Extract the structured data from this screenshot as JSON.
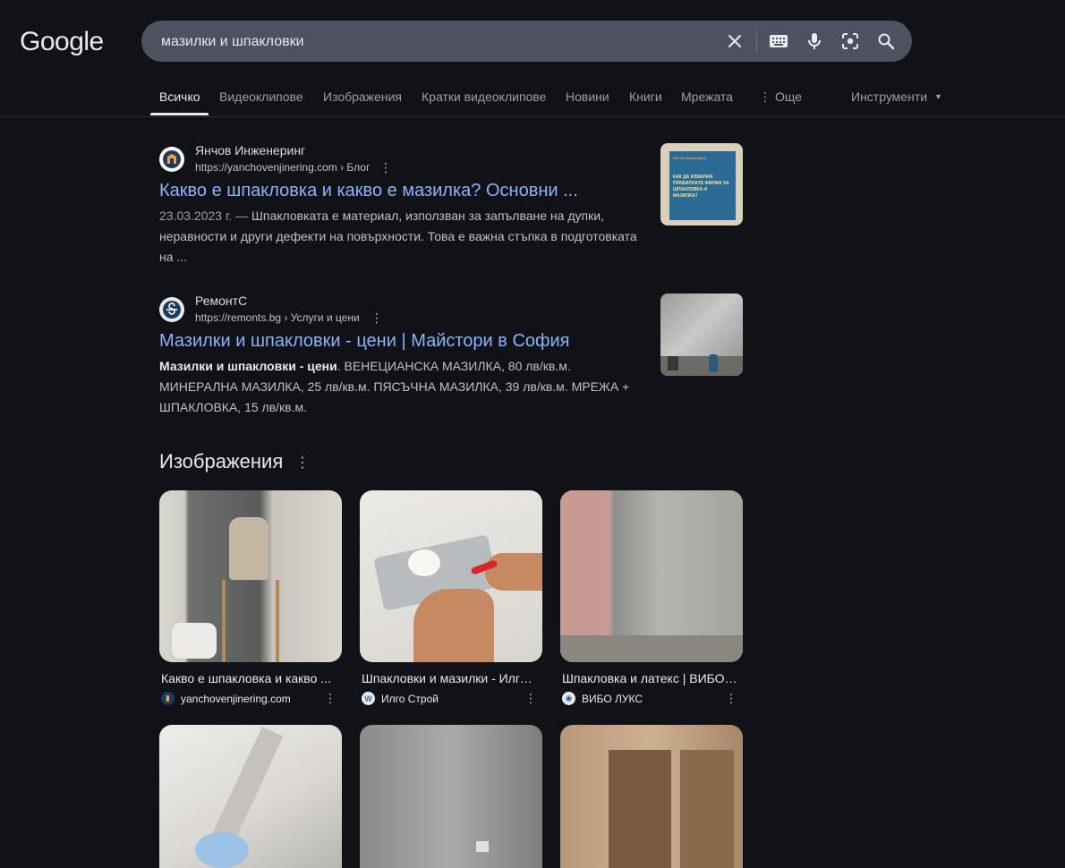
{
  "logo": "Google",
  "search": {
    "query": "мазилки и шпакловки"
  },
  "tabs": [
    "Всичко",
    "Видеоклипове",
    "Изображения",
    "Кратки видеоклипове",
    "Новини",
    "Книги",
    "Мрежата",
    "Още",
    "Инструменти"
  ],
  "results": [
    {
      "site": "Янчов Инженеринг",
      "url": "https://yanchovenjinering.com › Блог",
      "title": "Какво е шпакловка и какво е мазилка? Основни ...",
      "date": "23.03.2023 г. —",
      "snippet": "Шпакловката е материал, използван за запълване на дупки, неравности и други дефекти на повърхности. Това е важна стъпка в подготовката на ...",
      "thumb_lines": [
        "Янчов Инженеринг",
        "КАК ДА ИЗБЕРЕМ",
        "ПРАВИЛНАТА ФИРМА ЗА",
        "ШПАКЛОВКА И",
        "МАЗИЛКА?"
      ]
    },
    {
      "site": "РемонтС",
      "url": "https://remonts.bg › Услуги и цени",
      "title": "Мазилки и шпакловки - цени | Майстори в София",
      "snippet_bold": "Мазилки и шпакловки - цени",
      "snippet": ". ВЕНЕЦИАНСКА МАЗИЛКА, 80 лв/кв.м. МИНЕРАЛНА МАЗИЛКА, 25 лв/кв.м. ПЯСЪЧНА МАЗИЛКА, 39 лв/кв.м. МРЕЖА + ШПАКЛОВКА, 15 лв/кв.м."
    }
  ],
  "images": {
    "heading": "Изображения",
    "cards": [
      {
        "caption": "Какво е шпакловка и какво ...",
        "source": "yanchovenjinering.com"
      },
      {
        "caption": "Шпакловки и мазилки - Илго ...",
        "source": "Илго Строй"
      },
      {
        "caption": "Шпакловка и латекс | ВИБО ...",
        "source": "ВИБО ЛУКС"
      }
    ]
  },
  "colors": {
    "bg": "#101218",
    "link": "#8ab4f8",
    "searchbar": "#4d5160"
  }
}
